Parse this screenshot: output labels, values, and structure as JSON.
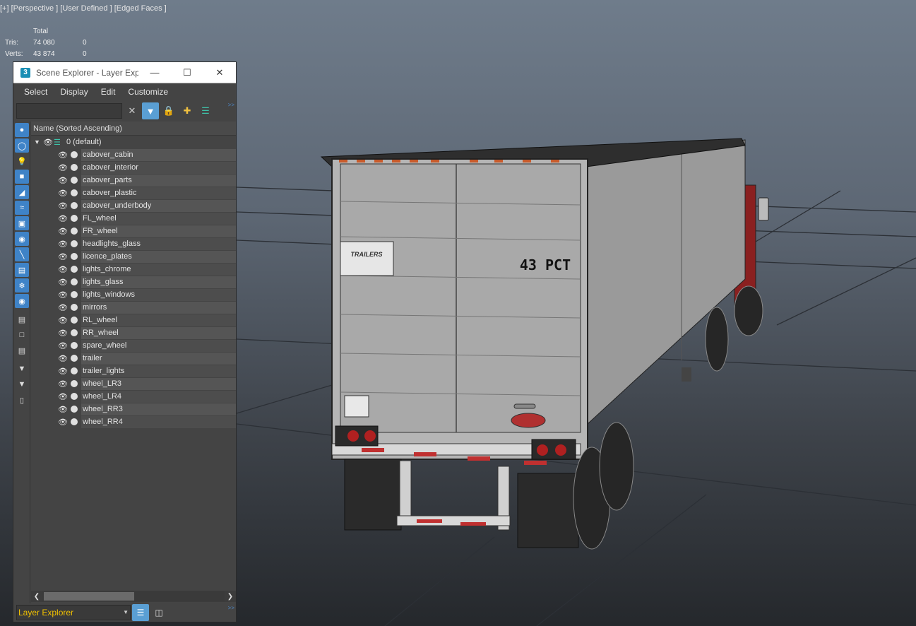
{
  "viewport": {
    "label": "[+] [Perspective ] [User Defined ] [Edged Faces ]",
    "stats": {
      "header": "Total",
      "rows": [
        {
          "label": "Tris:",
          "total": "74 080",
          "selected": "0"
        },
        {
          "label": "Verts:",
          "total": "43 874",
          "selected": "0"
        }
      ]
    },
    "trailer_text": "43 PCT",
    "logo_text": "TRAILERS"
  },
  "explorer": {
    "title": "Scene Explorer - Layer Expl...",
    "app_icon": "3",
    "menu": [
      "Select",
      "Display",
      "Edit",
      "Customize"
    ],
    "search_placeholder": "",
    "column_header": "Name (Sorted Ascending)",
    "layer": {
      "name": "0 (default)"
    },
    "objects": [
      "cabover_cabin",
      "cabover_interior",
      "cabover_parts",
      "cabover_plastic",
      "cabover_underbody",
      "FL_wheel",
      "FR_wheel",
      "headlights_glass",
      "licence_plates",
      "lights_chrome",
      "lights_glass",
      "lights_windows",
      "mirrors",
      "RL_wheel",
      "RR_wheel",
      "spare_wheel",
      "trailer",
      "trailer_lights",
      "wheel_LR3",
      "wheel_LR4",
      "wheel_RR3",
      "wheel_RR4"
    ],
    "bottom_select": "Layer Explorer",
    "accent_color": "#5a9fd4",
    "layer_icon_color": "#3fc1a8"
  }
}
